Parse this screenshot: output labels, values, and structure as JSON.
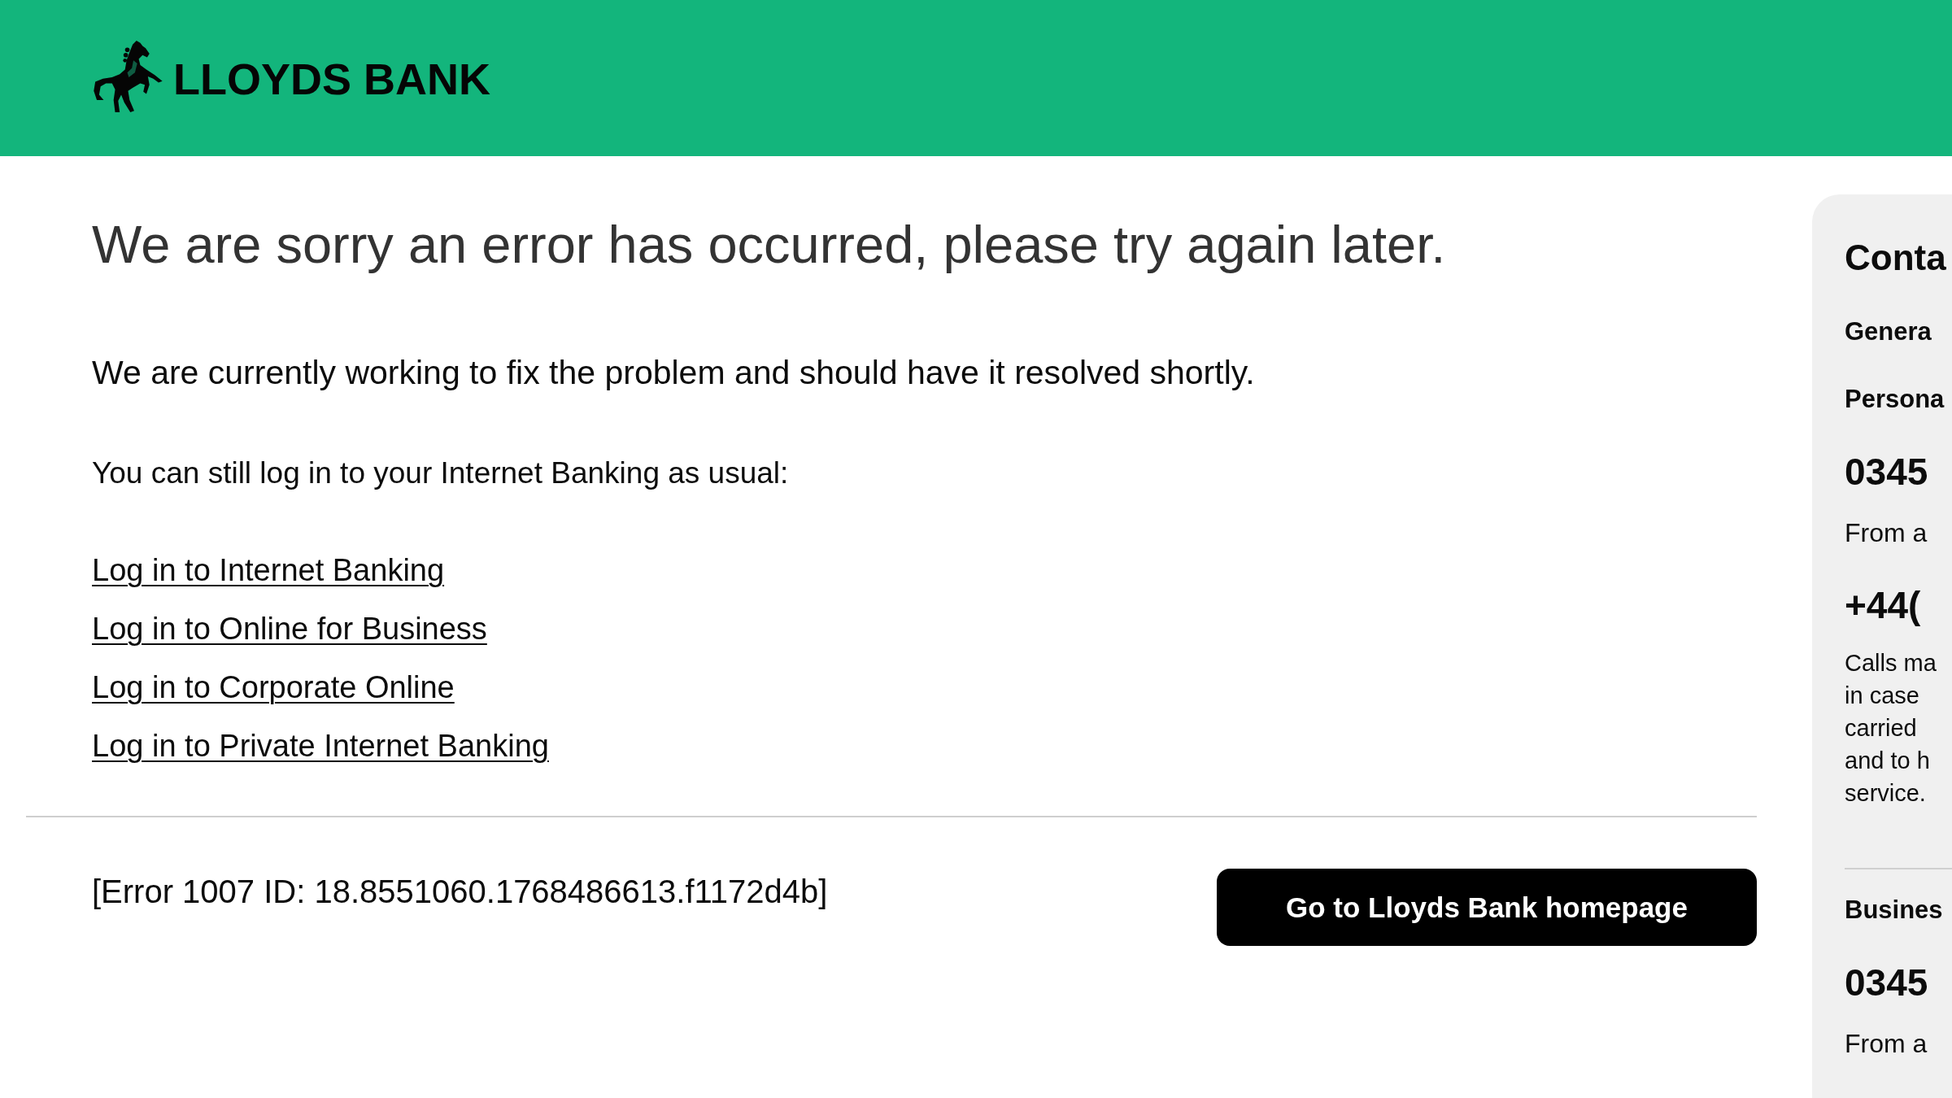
{
  "header": {
    "logo_text": "LLOYDS BANK"
  },
  "main": {
    "heading": "We are sorry an error has occurred, please try again later.",
    "message": "We are currently working to fix the problem and should have it resolved shortly.",
    "login_intro": "You can still log in to your Internet Banking as usual:",
    "login_links": [
      "Log in to Internet Banking",
      "Log in to Online for Business",
      "Log in to Corporate Online",
      "Log in to Private Internet Banking"
    ],
    "error_reference": "[Error 1007 ID: 18.8551060.1768486613.f1172d4b]",
    "homepage_button": "Go to Lloyds Bank homepage"
  },
  "contact_panel": {
    "title": "Conta",
    "sections": [
      {
        "items": [
          {
            "kind": "label",
            "text": "Genera"
          },
          {
            "kind": "label",
            "text": "Persona"
          },
          {
            "kind": "number",
            "text": "0345"
          },
          {
            "kind": "text",
            "text": "From a"
          },
          {
            "kind": "number",
            "text": "+44("
          },
          {
            "kind": "note",
            "lines": [
              "Calls ma",
              "in case",
              "carried",
              "and to h",
              "service."
            ]
          }
        ]
      },
      {
        "items": [
          {
            "kind": "label",
            "text": "Busines"
          },
          {
            "kind": "number",
            "text": "0345"
          },
          {
            "kind": "text",
            "text": "From a"
          }
        ]
      }
    ]
  }
}
